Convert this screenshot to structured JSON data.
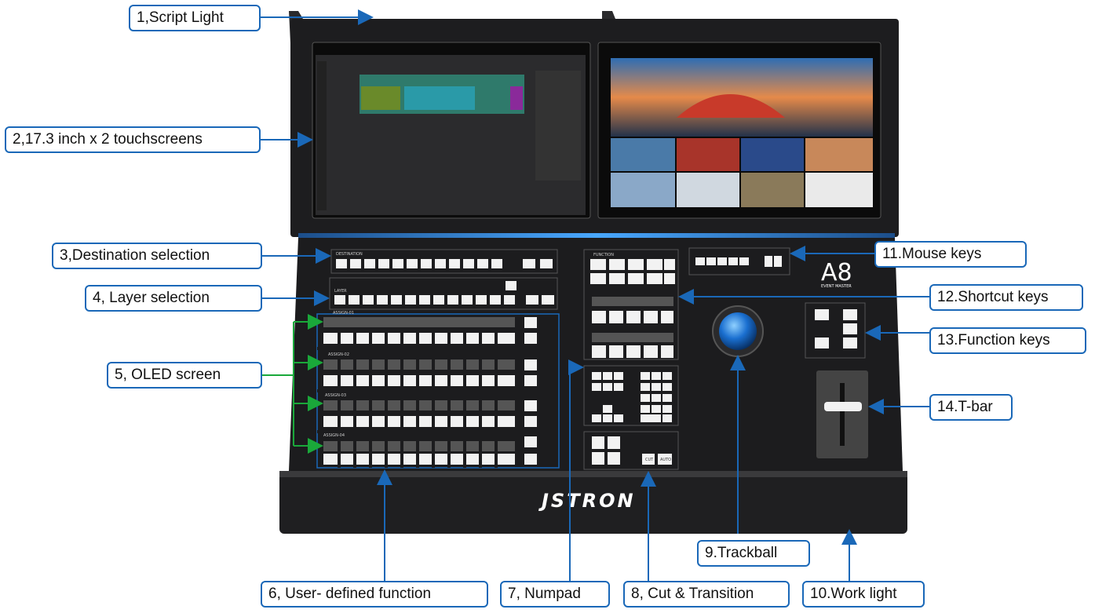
{
  "device": {
    "brand": "JSTRON",
    "model": "A8",
    "model_subtitle": "EVENT MASTER",
    "panel_labels": {
      "destination": "DESTINATION",
      "layer": "LAYER",
      "assign_1": "ASSIGN-01",
      "assign_2": "ASSIGN-02",
      "assign_3": "ASSIGN-03",
      "assign_4": "ASSIGN-04",
      "function": "FUNCTION",
      "cut": "CUT",
      "auto": "AUTO"
    }
  },
  "callouts": {
    "c1": "1,Script Light",
    "c2": "2,17.3 inch x 2 touchscreens",
    "c3": "3,Destination selection",
    "c4": "4, Layer selection",
    "c5": "5, OLED screen",
    "c6": "6, User- defined function",
    "c7": "7, Numpad",
    "c8": "8, Cut & Transition",
    "c9": "9.Trackball",
    "c10": "10.Work light",
    "c11": "11.Mouse keys",
    "c12": "12.Shortcut keys",
    "c13": "13.Function keys",
    "c14": "14.T-bar"
  },
  "colors": {
    "callout_border": "#1a68b8",
    "arrow_blue": "#1a68b8",
    "arrow_green": "#1aa83a",
    "console_body": "#1c1c1e",
    "accent_light": "#2f8fe8"
  }
}
